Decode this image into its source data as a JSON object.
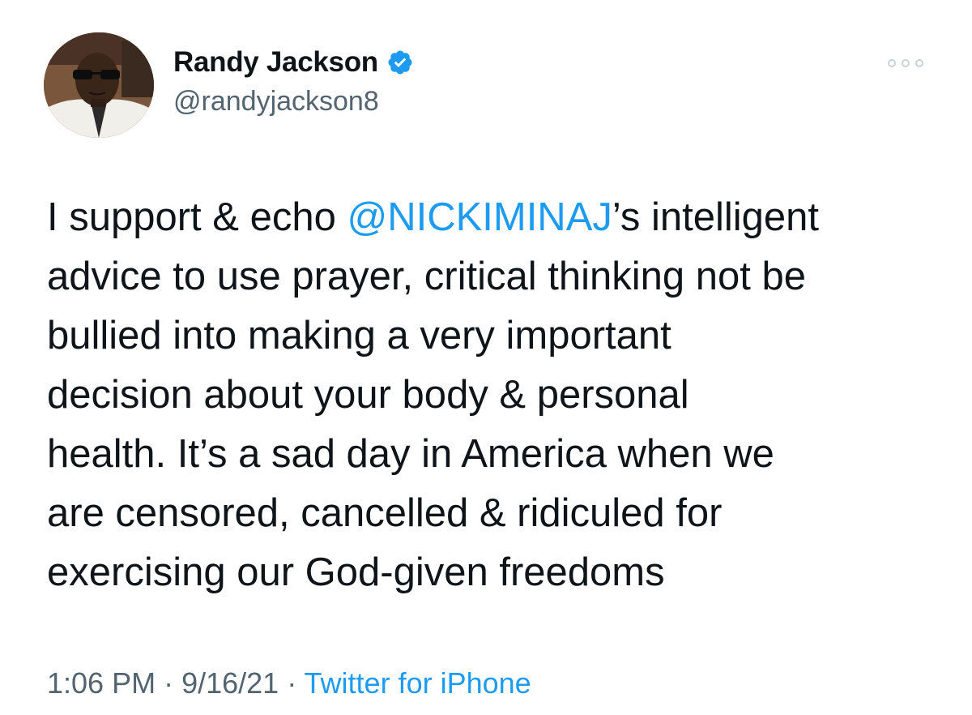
{
  "author": {
    "name": "Randy Jackson",
    "handle": "@randyjackson8",
    "verified": true
  },
  "tweet": {
    "lines": [
      [
        "I support & echo ",
        "@NICKIMINAJ",
        "’s intelligent"
      ],
      "advice to use prayer, critical thinking not be",
      "bullied into making a very important",
      "decision about your body & personal",
      "health. It’s a sad day in America when we",
      "are censored, cancelled & ridiculed for",
      "exercising our God-given freedoms"
    ]
  },
  "meta": {
    "time": "1:06 PM",
    "date": "9/16/21",
    "separator": " · ",
    "source": "Twitter for iPhone"
  },
  "icons": {
    "verified": "verified-badge-icon",
    "more": "more-options-icon"
  },
  "colors": {
    "accent": "#1d9bf0",
    "text": "#0f1419",
    "secondary": "#536471"
  }
}
